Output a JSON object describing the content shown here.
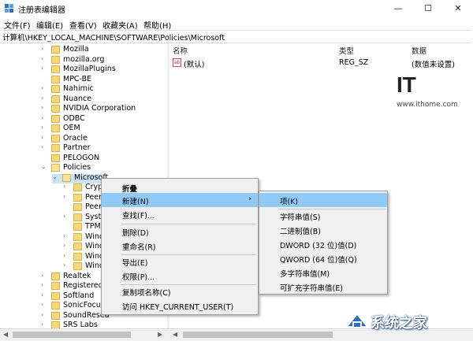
{
  "window": {
    "title": "注册表编辑器",
    "minimize": "—",
    "maximize": "☐",
    "close": "✕"
  },
  "menu": [
    "文件(F)",
    "编辑(E)",
    "查看(V)",
    "收藏夹(A)",
    "帮助(H)"
  ],
  "address": "计算机\\HKEY_LOCAL_MACHINE\\SOFTWARE\\Policies\\Microsoft",
  "tree": [
    "Mozilla",
    "mozilla.org",
    "MozillaPlugins",
    "MPC-BE",
    "Nahimic",
    "Nuance",
    "NVIDIA Corporation",
    "ODBC",
    "OEM",
    "Oracle",
    "Partner",
    "PELOGON",
    "Policies",
    "Microsoft",
    "Crypt",
    "Peer",
    "Peer",
    "Syste",
    "TPM",
    "Wind",
    "Wind",
    "Wind",
    "Wind",
    "Realtek",
    "RegisteredAp",
    "Softland",
    "SonicFocus",
    "SoundResea",
    "SRS Labs"
  ],
  "list": {
    "headers": {
      "name": "名称",
      "type": "类型",
      "data": "数据"
    },
    "row": {
      "name": "(默认)",
      "type": "REG_SZ",
      "data": "(数值未设置)",
      "icon_text": "ab"
    }
  },
  "context_menu": {
    "items": [
      "折叠",
      "新建(N)",
      "查找(F)...",
      "删除(D)",
      "重命名(R)",
      "导出(E)",
      "权限(P)...",
      "复制项名称(C)",
      "访问 HKEY_CURRENT_USER(T)"
    ],
    "submenu_arrow": "›"
  },
  "submenu": {
    "items": [
      "项(K)",
      "字符串值(S)",
      "二进制值(B)",
      "DWORD (32 位)值(D)",
      "QWORD (64 位)值(Q)",
      "多字符串值(M)",
      "可扩充字符串值(E)"
    ]
  },
  "watermark": {
    "logo": "IT",
    "url": "www.ithome.com",
    "site": "系统之家"
  },
  "colors": {
    "highlight": "#91c9f7",
    "selection": "#cce4f7",
    "folder": "#f6d879"
  }
}
